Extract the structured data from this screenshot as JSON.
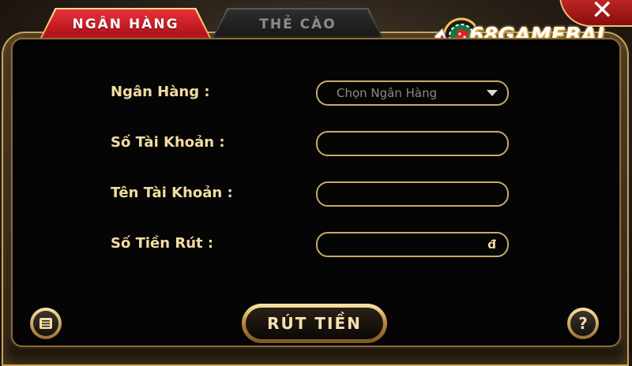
{
  "tabs": {
    "bank": "NGÂN HÀNG",
    "card": "THẺ CÀO"
  },
  "logo": {
    "text": "68GAMEBAI",
    "prefix": "6"
  },
  "close": {
    "symbol": "✕"
  },
  "form": {
    "bank_label": "Ngân Hàng :",
    "bank_select": "Chọn Ngân Hàng",
    "account_number_label": "Số Tài Khoản :",
    "account_name_label": "Tên Tài Khoản :",
    "amount_label": "Số Tiền Rút :",
    "currency": "đ"
  },
  "buttons": {
    "withdraw": "RÚT TIỀN",
    "help": "?"
  },
  "colors": {
    "gold": "#f3dca0",
    "tab_active": "#d41c25",
    "panel": "#050505"
  }
}
